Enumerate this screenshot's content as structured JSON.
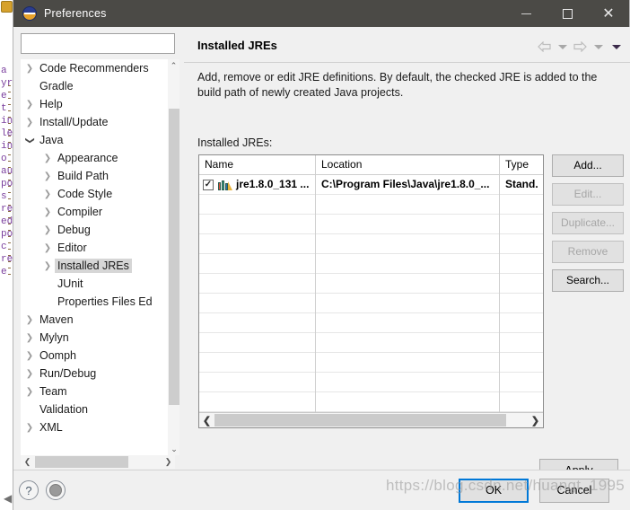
{
  "backdrop": {
    "lines": [
      "a",
      "yr",
      "e",
      "",
      "",
      "",
      "",
      "",
      "",
      "",
      "",
      "",
      "",
      "",
      "",
      "",
      "t",
      "in",
      "le",
      "",
      "in",
      "o",
      "au",
      "po",
      "s",
      "re",
      "ed",
      "po",
      "c",
      "",
      "re",
      "e"
    ]
  },
  "window": {
    "title": "Preferences",
    "icon": "eclipse-icon",
    "minimize_label": "—",
    "maximize_label": "□",
    "close_label": "✕"
  },
  "sidebar": {
    "filter_value": "",
    "filter_placeholder": "",
    "items": [
      {
        "label": "Code Recommenders",
        "depth": 1,
        "twisty": "right",
        "selected": false
      },
      {
        "label": "Gradle",
        "depth": 1,
        "twisty": "none",
        "selected": false
      },
      {
        "label": "Help",
        "depth": 1,
        "twisty": "right",
        "selected": false
      },
      {
        "label": "Install/Update",
        "depth": 1,
        "twisty": "right",
        "selected": false
      },
      {
        "label": "Java",
        "depth": 1,
        "twisty": "down",
        "selected": false
      },
      {
        "label": "Appearance",
        "depth": 2,
        "twisty": "right",
        "selected": false
      },
      {
        "label": "Build Path",
        "depth": 2,
        "twisty": "right",
        "selected": false
      },
      {
        "label": "Code Style",
        "depth": 2,
        "twisty": "right",
        "selected": false
      },
      {
        "label": "Compiler",
        "depth": 2,
        "twisty": "right",
        "selected": false
      },
      {
        "label": "Debug",
        "depth": 2,
        "twisty": "right",
        "selected": false
      },
      {
        "label": "Editor",
        "depth": 2,
        "twisty": "right",
        "selected": false
      },
      {
        "label": "Installed JREs",
        "depth": 2,
        "twisty": "right",
        "selected": true
      },
      {
        "label": "JUnit",
        "depth": 2,
        "twisty": "none",
        "selected": false
      },
      {
        "label": "Properties Files Ed",
        "depth": 2,
        "twisty": "none",
        "selected": false
      },
      {
        "label": "Maven",
        "depth": 1,
        "twisty": "right",
        "selected": false
      },
      {
        "label": "Mylyn",
        "depth": 1,
        "twisty": "right",
        "selected": false
      },
      {
        "label": "Oomph",
        "depth": 1,
        "twisty": "right",
        "selected": false
      },
      {
        "label": "Run/Debug",
        "depth": 1,
        "twisty": "right",
        "selected": false
      },
      {
        "label": "Team",
        "depth": 1,
        "twisty": "right",
        "selected": false
      },
      {
        "label": "Validation",
        "depth": 1,
        "twisty": "none",
        "selected": false
      },
      {
        "label": "XML",
        "depth": 1,
        "twisty": "right",
        "selected": false
      }
    ],
    "scroll_up": "⌃",
    "scroll_down": "⌄",
    "scroll_left": "❮",
    "scroll_right": "❯"
  },
  "page": {
    "title": "Installed JREs",
    "description": "Add, remove or edit JRE definitions. By default, the checked JRE is added to the build path of newly created Java projects.",
    "list_label": "Installed JREs:",
    "nav": {
      "back_icon": "back-arrow-icon",
      "back_menu_icon": "chevron-down-icon",
      "forward_icon": "forward-arrow-icon",
      "forward_menu_icon": "chevron-down-icon",
      "more_menu_icon": "chevron-down-icon"
    }
  },
  "table": {
    "columns": [
      "Name",
      "Location",
      "Type"
    ],
    "rows": [
      {
        "checked": true,
        "name": "jre1.8.0_131 ...",
        "location": "C:\\Program Files\\Java\\jre1.8.0_...",
        "type": "Stand.",
        "icon": "jre-library-icon"
      }
    ],
    "empty_row_count": 11,
    "scroll_left": "❮",
    "scroll_right": "❯"
  },
  "side_buttons": [
    {
      "label": "Add...",
      "disabled": false
    },
    {
      "label": "Edit...",
      "disabled": true
    },
    {
      "label": "Duplicate...",
      "disabled": true
    },
    {
      "label": "Remove",
      "disabled": true
    },
    {
      "label": "Search...",
      "disabled": false
    }
  ],
  "footer": {
    "apply_label": "Apply",
    "ok_label": "OK",
    "cancel_label": "Cancel",
    "help_label": "?",
    "record_icon": "record-button-icon"
  },
  "watermark": "https://blog.csdn.net/huangt_1995",
  "colors": {
    "titlebar": "#4b4a46",
    "dialog_bg": "#f0f0f0",
    "accent": "#0078d7",
    "selection": "#d6d6d6"
  }
}
